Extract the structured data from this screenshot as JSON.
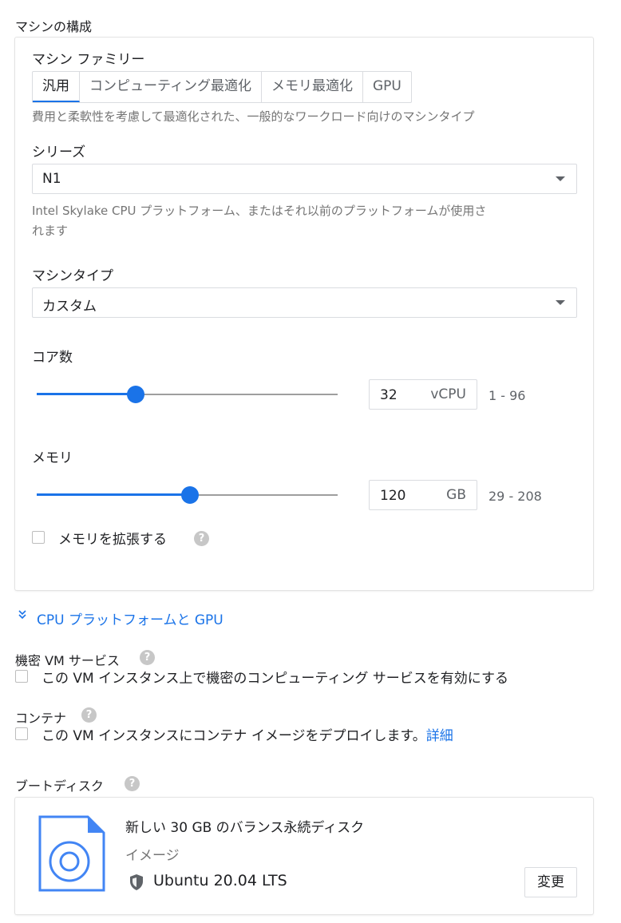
{
  "machine_config": {
    "title": "マシンの構成",
    "family_label": "マシン ファミリー",
    "family_tabs": [
      {
        "label": "汎用",
        "active": true
      },
      {
        "label": "コンピューティング最適化",
        "active": false
      },
      {
        "label": "メモリ最適化",
        "active": false
      },
      {
        "label": "GPU",
        "active": false
      }
    ],
    "family_description": "費用と柔軟性を考慮して最適化された、一般的なワークロード向けのマシンタイプ",
    "series_label": "シリーズ",
    "series_value": "N1",
    "series_description_line1": "Intel Skylake CPU プラットフォーム、またはそれ以前のプラットフォームが使用さ",
    "series_description_line2": "れます",
    "type_label": "マシンタイプ",
    "type_value": "カスタム",
    "cores": {
      "label": "コア数",
      "value": "32",
      "unit": "vCPU",
      "range": "1 - 96",
      "slider_fraction": 0.33
    },
    "memory": {
      "label": "メモリ",
      "value": "120",
      "unit": "GB",
      "range": "29 - 208",
      "slider_fraction": 0.51
    },
    "extend_memory_label": "メモリを拡張する",
    "extend_memory_checked": false
  },
  "cpu_platform_link": "CPU プラットフォームと GPU",
  "confidential": {
    "title": "機密 VM サービス",
    "checkbox_label": "この VM インスタンス上で機密のコンピューティング サービスを有効にする",
    "checked": false
  },
  "container": {
    "title": "コンテナ",
    "checkbox_label": "この VM インスタンスにコンテナ イメージをデプロイします。",
    "link": "詳細",
    "checked": false
  },
  "boot_disk": {
    "title": "ブートディスク",
    "description": "新しい 30 GB のバランス永続ディスク",
    "image_label": "イメージ",
    "image_value": "Ubuntu 20.04 LTS",
    "change_button": "変更"
  },
  "colors": {
    "accent": "#1a73e8",
    "help_icon": "#c7c7c7"
  },
  "icons": {
    "help": "help-circle-icon",
    "expand": "double-chevron-down-icon",
    "disk": "disk-file-icon",
    "shield": "shield-icon",
    "dropdown": "caret-down-icon"
  }
}
